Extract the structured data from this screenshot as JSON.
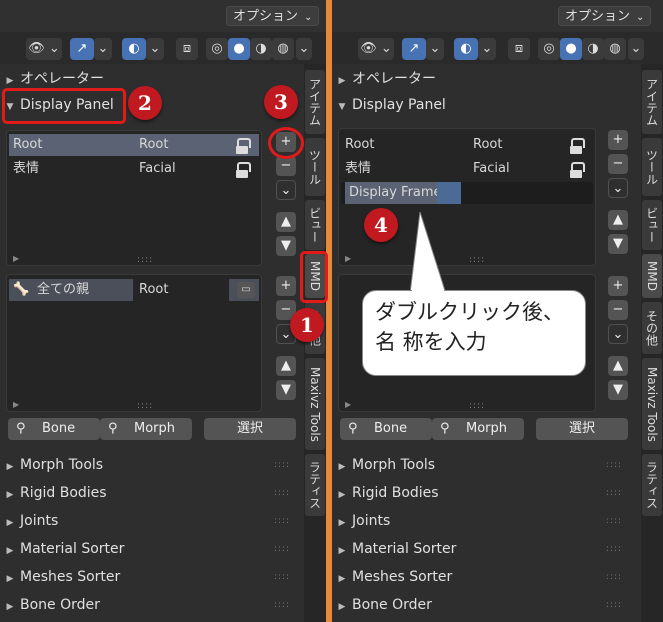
{
  "header": {
    "options_label": "オプション"
  },
  "left": {
    "sections_top": [
      {
        "label": "オペレーター"
      },
      {
        "label": "Display Panel"
      }
    ],
    "frames": [
      {
        "name": "Root",
        "type": "Root"
      },
      {
        "name": "表情",
        "type": "Facial"
      }
    ],
    "item": {
      "name": "全ての親",
      "value": "Root"
    },
    "buttons": {
      "bone": "Bone",
      "morph": "Morph",
      "select": "選択"
    },
    "sections_bottom": [
      {
        "label": "Morph Tools"
      },
      {
        "label": "Rigid Bodies"
      },
      {
        "label": "Joints"
      },
      {
        "label": "Material Sorter"
      },
      {
        "label": "Meshes Sorter"
      },
      {
        "label": "Bone Order"
      }
    ],
    "tabs": [
      "アイテム",
      "ツール",
      "ビュー",
      "MMD",
      "その他",
      "Maxivz Tools",
      "ラティス"
    ]
  },
  "right": {
    "sections_top": [
      {
        "label": "オペレーター"
      },
      {
        "label": "Display Panel"
      }
    ],
    "frames": [
      {
        "name": "Root",
        "type": "Root"
      },
      {
        "name": "表情",
        "type": "Facial"
      }
    ],
    "new_frame_text": "Display Frame",
    "bubble_line1": "ダブルクリック後、",
    "bubble_line2": "名 称を入力",
    "buttons": {
      "bone": "Bone",
      "morph": "Morph",
      "select": "選択"
    },
    "sections_bottom": [
      {
        "label": "Morph Tools"
      },
      {
        "label": "Rigid Bodies"
      },
      {
        "label": "Joints"
      },
      {
        "label": "Material Sorter"
      },
      {
        "label": "Meshes Sorter"
      },
      {
        "label": "Bone Order"
      }
    ],
    "tabs": [
      "アイテム",
      "ツール",
      "ビュー",
      "MMD",
      "その他",
      "Maxivz Tools",
      "ラティス"
    ]
  },
  "callouts": [
    "1",
    "2",
    "3",
    "4"
  ],
  "colors": {
    "accent": "#4772b3",
    "callout": "#c0191f",
    "divider": "#e8893a"
  }
}
